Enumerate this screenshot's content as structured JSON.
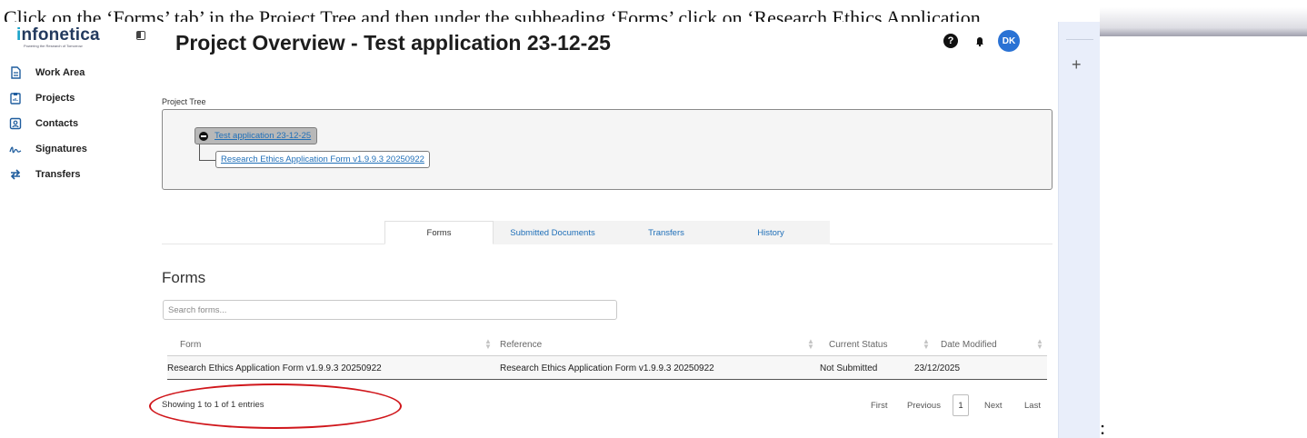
{
  "document": {
    "instruction_text": "Click on the ‘Forms’ tab’ in the Project Tree and then under the subheading ‘Forms’ click on ‘Research Ethics Application",
    "trailing_colon": ":"
  },
  "brand": {
    "logo_prefix": "i",
    "logo_rest": "nfonetica",
    "tagline": "Powering the Research of Tomorrow"
  },
  "sidebar": {
    "items": [
      {
        "label": "Work Area",
        "icon": "document-icon"
      },
      {
        "label": "Projects",
        "icon": "clipboard-icon"
      },
      {
        "label": "Contacts",
        "icon": "contact-card-icon"
      },
      {
        "label": "Signatures",
        "icon": "signature-icon"
      },
      {
        "label": "Transfers",
        "icon": "transfer-arrows-icon"
      }
    ]
  },
  "header": {
    "title": "Project Overview - Test application 23-12-25",
    "help_glyph": "?",
    "bell_glyph": "●",
    "avatar_initials": "DK"
  },
  "right_panel": {
    "plus_glyph": "+"
  },
  "project_tree": {
    "label": "Project Tree",
    "root": "Test application 23-12-25",
    "child": "Research Ethics Application Form v1.9.9.3 20250922"
  },
  "tabs": [
    {
      "label": "Forms",
      "active": true
    },
    {
      "label": "Submitted Documents",
      "active": false
    },
    {
      "label": "Transfers",
      "active": false
    },
    {
      "label": "History",
      "active": false
    }
  ],
  "forms": {
    "heading": "Forms",
    "search_placeholder": "Search forms...",
    "columns": [
      "Form",
      "Reference",
      "Current Status",
      "Date Modified"
    ],
    "rows": [
      {
        "form": "Research Ethics Application Form v1.9.9.3 20250922",
        "reference": "Research Ethics Application Form v1.9.9.3 20250922",
        "status": "Not Submitted",
        "date": "23/12/2025"
      }
    ],
    "entries_text": "Showing 1 to 1 of 1 entries"
  },
  "pagination": {
    "first": "First",
    "previous": "Previous",
    "current": "1",
    "next": "Next",
    "last": "Last"
  },
  "colors": {
    "accent": "#1f6fb8",
    "brand_navy": "#233a5e",
    "avatar": "#2a72d4",
    "annotation_red": "#d0161b"
  }
}
